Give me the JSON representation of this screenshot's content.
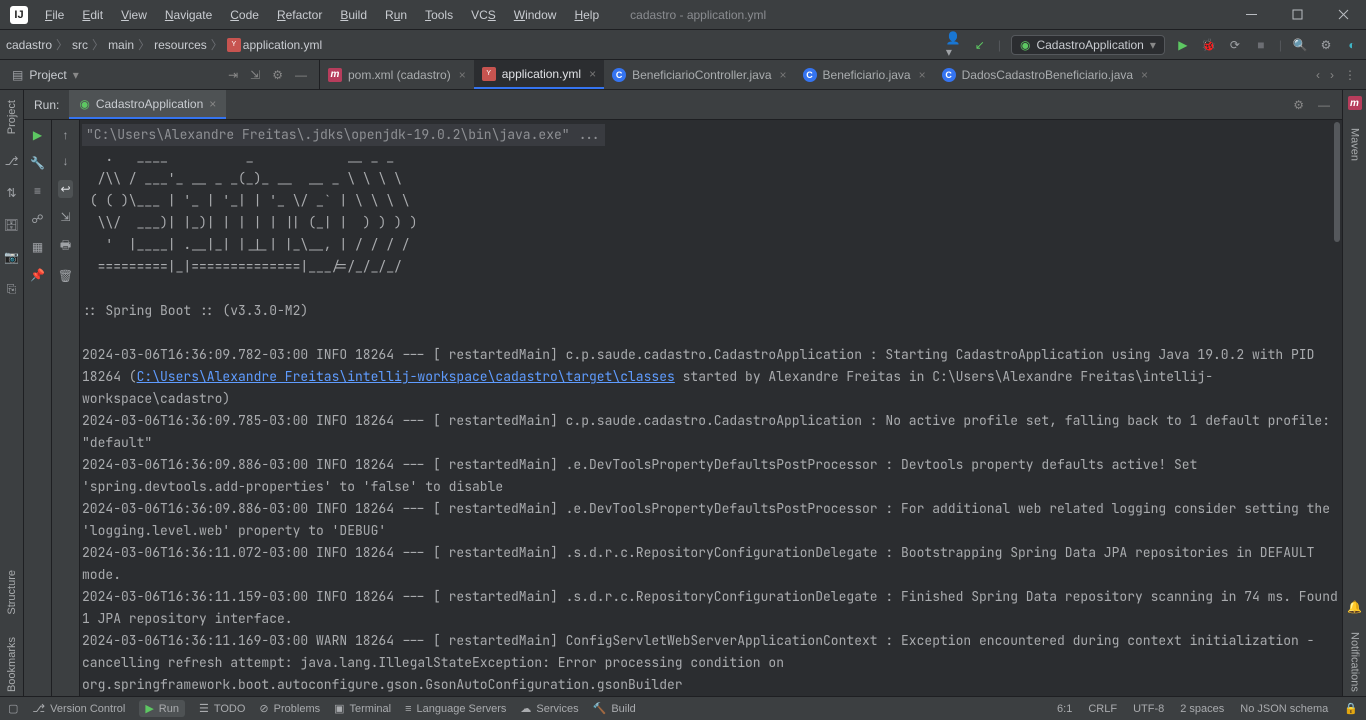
{
  "window_title": "cadastro - application.yml",
  "menu": [
    "File",
    "Edit",
    "View",
    "Navigate",
    "Code",
    "Refactor",
    "Build",
    "Run",
    "Tools",
    "VCS",
    "Window",
    "Help"
  ],
  "breadcrumbs": [
    "cadastro",
    "src",
    "main",
    "resources",
    "application.yml"
  ],
  "run_config": "CadastroApplication",
  "project_label": "Project",
  "sidebar_left": {
    "project": "Project",
    "structure": "Structure",
    "bookmarks": "Bookmarks"
  },
  "sidebar_right": {
    "maven": "Maven",
    "notifications": "Notifications"
  },
  "tabs": [
    {
      "label": "pom.xml (cadastro)",
      "type": "m",
      "active": false
    },
    {
      "label": "application.yml",
      "type": "yml",
      "active": true
    },
    {
      "label": "BeneficiarioController.java",
      "type": "java",
      "active": false
    },
    {
      "label": "Beneficiario.java",
      "type": "java",
      "active": false
    },
    {
      "label": "DadosCadastroBeneficiario.java",
      "type": "java",
      "active": false
    }
  ],
  "run_panel": {
    "title": "Run:",
    "tab_name": "CadastroApplication"
  },
  "console": {
    "cmd": "\"C:\\Users\\Alexandre Freitas\\.jdks\\openjdk-19.0.2\\bin\\java.exe\" ...",
    "banner": "   .   ____          _            __ _ _\n  /\\\\ / ___'_ __ _ _(_)_ __  __ _ \\ \\ \\ \\\n ( ( )\\___ | '_ | '_| | '_ \\/ _` | \\ \\ \\ \\\n  \\\\/  ___)| |_)| | | | | || (_| |  ) ) ) )\n   '  |____| .__|_| |_|_| |_\\__, | / / / /\n  =========|_|==============|___/=/_/_/_/",
    "boot_line": " :: Spring Boot ::             (v3.3.0-M2)",
    "log1_a": "2024-03-06T16:36:09.782-03:00  INFO 18264 --- [  restartedMain] c.p.saude.cadastro.CadastroApplication   : Starting CadastroApplication using Java 19.0.2 with PID 18264 (",
    "log1_link": "C:\\Users\\Alexandre Freitas\\intellij-workspace\\cadastro\\target\\classes",
    "log1_b": " started by Alexandre Freitas in C:\\Users\\Alexandre Freitas\\intellij-workspace\\cadastro)",
    "log2": "2024-03-06T16:36:09.785-03:00  INFO 18264 --- [  restartedMain] c.p.saude.cadastro.CadastroApplication   : No active profile set, falling back to 1 default profile: \"default\"",
    "log3": "2024-03-06T16:36:09.886-03:00  INFO 18264 --- [  restartedMain] .e.DevToolsPropertyDefaultsPostProcessor : Devtools property defaults active! Set 'spring.devtools.add-properties' to 'false' to disable",
    "log4": "2024-03-06T16:36:09.886-03:00  INFO 18264 --- [  restartedMain] .e.DevToolsPropertyDefaultsPostProcessor : For additional web related logging consider setting the 'logging.level.web' property to 'DEBUG'",
    "log5": "2024-03-06T16:36:11.072-03:00  INFO 18264 --- [  restartedMain] .s.d.r.c.RepositoryConfigurationDelegate : Bootstrapping Spring Data JPA repositories in DEFAULT mode.",
    "log6": "2024-03-06T16:36:11.159-03:00  INFO 18264 --- [  restartedMain] .s.d.r.c.RepositoryConfigurationDelegate : Finished Spring Data repository scanning in 74 ms. Found 1 JPA repository interface.",
    "log7": "2024-03-06T16:36:11.169-03:00  WARN 18264 --- [  restartedMain] ConfigServletWebServerApplicationContext : Exception encountered during context initialization - cancelling refresh attempt: java.lang.IllegalStateException: Error processing condition on org.springframework.boot.autoconfigure.gson.GsonAutoConfiguration.gsonBuilder"
  },
  "status_tools": {
    "version_control": "Version Control",
    "run": "Run",
    "todo": "TODO",
    "problems": "Problems",
    "terminal": "Terminal",
    "lang": "Language Servers",
    "services": "Services",
    "build": "Build"
  },
  "status_right": {
    "pos": "6:1",
    "crlf": "CRLF",
    "enc": "UTF-8",
    "indent": "2 spaces",
    "schema": "No JSON schema"
  }
}
